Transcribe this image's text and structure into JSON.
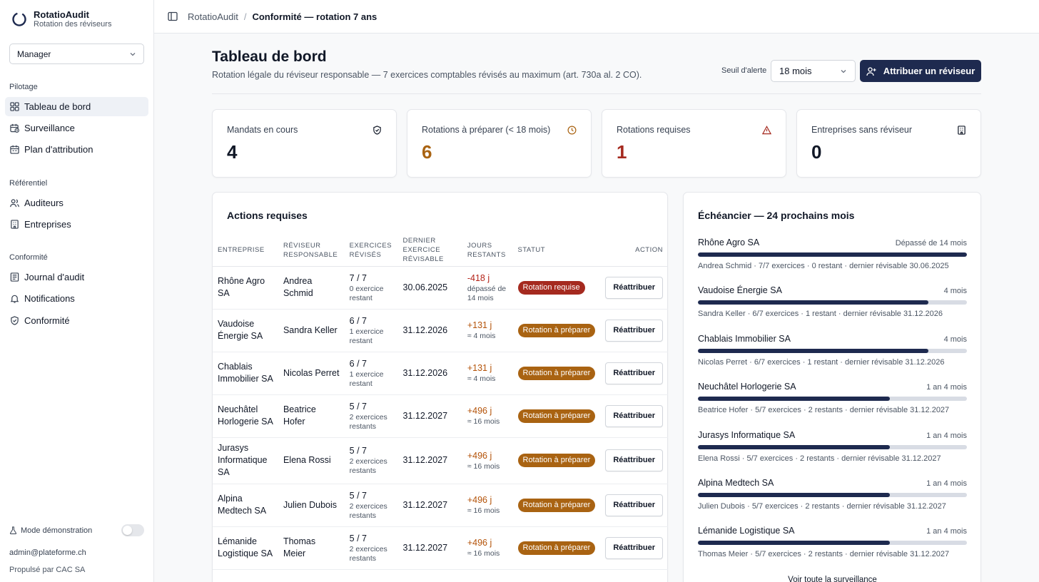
{
  "app": {
    "name": "RotatioAudit",
    "subtitle": "Rotation des réviseurs"
  },
  "role_select": {
    "value": "Manager"
  },
  "nav": {
    "sections": [
      {
        "label": "Pilotage"
      },
      {
        "label": "Référentiel"
      },
      {
        "label": "Conformité"
      }
    ],
    "items": [
      {
        "label": "Tableau de bord",
        "icon": "grid-icon"
      },
      {
        "label": "Surveillance",
        "icon": "calendar-clock-icon"
      },
      {
        "label": "Plan d'attribution",
        "icon": "calendar-icon"
      },
      {
        "label": "Auditeurs",
        "icon": "users-icon"
      },
      {
        "label": "Entreprises",
        "icon": "building-icon"
      },
      {
        "label": "Journal d'audit",
        "icon": "list-icon"
      },
      {
        "label": "Notifications",
        "icon": "bell-icon"
      },
      {
        "label": "Conformité",
        "icon": "shield-check-icon"
      }
    ]
  },
  "footer": {
    "demo_label": "Mode démonstration",
    "demo_enabled": false,
    "email": "admin@plateforme.ch",
    "powered": "Propulsé par CAC SA"
  },
  "breadcrumb": {
    "root": "RotatioAudit",
    "current": "Conformité — rotation 7 ans"
  },
  "header": {
    "title": "Tableau de bord",
    "subtitle": "Rotation légale du réviseur responsable — 7 exercices comptables révisés au maximum (art. 730a al. 2 CO).",
    "threshold_label": "Seuil d'alerte",
    "threshold_value": "18 mois",
    "assign_button": "Attribuer un réviseur"
  },
  "colors": {
    "accent": "#1e2a4f",
    "danger": "#a52a1f",
    "warning": "#a96312",
    "danger_text": "#b42318",
    "warning_text": "#b45309"
  },
  "stats": [
    {
      "label": "Mandats en cours",
      "value": "4",
      "icon": "shield-check-icon",
      "color": "#111827"
    },
    {
      "label": "Rotations à préparer (< 18 mois)",
      "value": "6",
      "icon": "clock-icon",
      "color": "#a96312"
    },
    {
      "label": "Rotations requises",
      "value": "1",
      "icon": "alert-triangle-icon",
      "color": "#a52a1f"
    },
    {
      "label": "Entreprises sans réviseur",
      "value": "0",
      "icon": "building-icon",
      "color": "#111827"
    }
  ],
  "actions": {
    "title": "Actions requises",
    "columns": [
      "Entreprise",
      "Réviseur responsable",
      "Exercices révisés",
      "Dernier exercice révisable",
      "Jours restants",
      "Statut",
      "Action"
    ],
    "rows": [
      {
        "company": "Rhône Agro SA",
        "reviewer": "Andrea Schmid",
        "exercises": "7 / 7",
        "remaining": "0 exercice restant",
        "last": "30.06.2025",
        "days": "-418 j",
        "days_sub": "dépassé de 14 mois",
        "status": "Rotation requise",
        "level": "red",
        "action": "Réattribuer"
      },
      {
        "company": "Vaudoise Énergie SA",
        "reviewer": "Sandra Keller",
        "exercises": "6 / 7",
        "remaining": "1 exercice restant",
        "last": "31.12.2026",
        "days": "+131 j",
        "days_sub": "≈ 4 mois",
        "status": "Rotation à préparer",
        "level": "amb",
        "action": "Réattribuer"
      },
      {
        "company": "Chablais Immobilier SA",
        "reviewer": "Nicolas Perret",
        "exercises": "6 / 7",
        "remaining": "1 exercice restant",
        "last": "31.12.2026",
        "days": "+131 j",
        "days_sub": "≈ 4 mois",
        "status": "Rotation à préparer",
        "level": "amb",
        "action": "Réattribuer"
      },
      {
        "company": "Neuchâtel Horlogerie SA",
        "reviewer": "Beatrice Hofer",
        "exercises": "5 / 7",
        "remaining": "2 exercices restants",
        "last": "31.12.2027",
        "days": "+496 j",
        "days_sub": "≈ 16 mois",
        "status": "Rotation à préparer",
        "level": "amb",
        "action": "Réattribuer"
      },
      {
        "company": "Jurasys Informatique SA",
        "reviewer": "Elena Rossi",
        "exercises": "5 / 7",
        "remaining": "2 exercices restants",
        "last": "31.12.2027",
        "days": "+496 j",
        "days_sub": "≈ 16 mois",
        "status": "Rotation à préparer",
        "level": "amb",
        "action": "Réattribuer"
      },
      {
        "company": "Alpina Medtech SA",
        "reviewer": "Julien Dubois",
        "exercises": "5 / 7",
        "remaining": "2 exercices restants",
        "last": "31.12.2027",
        "days": "+496 j",
        "days_sub": "≈ 16 mois",
        "status": "Rotation à préparer",
        "level": "amb",
        "action": "Réattribuer"
      },
      {
        "company": "Lémanide Logistique SA",
        "reviewer": "Thomas Meier",
        "exercises": "5 / 7",
        "remaining": "2 exercices restants",
        "last": "31.12.2027",
        "days": "+496 j",
        "days_sub": "≈ 16 mois",
        "status": "Rotation à préparer",
        "level": "amb",
        "action": "Réattribuer"
      }
    ]
  },
  "timeline": {
    "title": "Échéancier — 24 prochains mois",
    "items": [
      {
        "company": "Rhône Agro SA",
        "due": "Dépassé de 14 mois",
        "progress": 1.0,
        "meta": "Andrea Schmid · 7/7 exercices · 0 restant · dernier révisable 30.06.2025"
      },
      {
        "company": "Vaudoise Énergie SA",
        "due": "4 mois",
        "progress": 0.857,
        "meta": "Sandra Keller · 6/7 exercices · 1 restant · dernier révisable 31.12.2026"
      },
      {
        "company": "Chablais Immobilier SA",
        "due": "4 mois",
        "progress": 0.857,
        "meta": "Nicolas Perret · 6/7 exercices · 1 restant · dernier révisable 31.12.2026"
      },
      {
        "company": "Neuchâtel Horlogerie SA",
        "due": "1 an 4 mois",
        "progress": 0.714,
        "meta": "Beatrice Hofer · 5/7 exercices · 2 restants · dernier révisable 31.12.2027"
      },
      {
        "company": "Jurasys Informatique SA",
        "due": "1 an 4 mois",
        "progress": 0.714,
        "meta": "Elena Rossi · 5/7 exercices · 2 restants · dernier révisable 31.12.2027"
      },
      {
        "company": "Alpina Medtech SA",
        "due": "1 an 4 mois",
        "progress": 0.714,
        "meta": "Julien Dubois · 5/7 exercices · 2 restants · dernier révisable 31.12.2027"
      },
      {
        "company": "Lémanide Logistique SA",
        "due": "1 an 4 mois",
        "progress": 0.714,
        "meta": "Thomas Meier · 5/7 exercices · 2 restants · dernier révisable 31.12.2027"
      }
    ],
    "more_link": "Voir toute la surveillance"
  }
}
